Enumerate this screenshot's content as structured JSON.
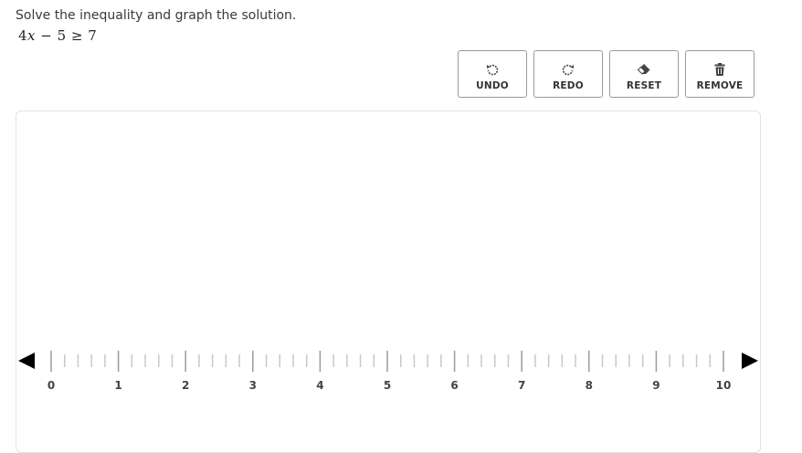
{
  "prompt": "Solve the inequality and graph the solution.",
  "equation": {
    "coef": "4",
    "var": "x",
    "rest": " − 5 ≥ 7"
  },
  "toolbar": {
    "undo": {
      "label": "UNDO",
      "icon": "undo-icon"
    },
    "redo": {
      "label": "REDO",
      "icon": "redo-icon"
    },
    "reset": {
      "label": "RESET",
      "icon": "eraser-icon"
    },
    "remove": {
      "label": "REMOVE",
      "icon": "trash-icon"
    }
  },
  "number_line": {
    "min": 0,
    "max": 10,
    "minor_per_unit": 5,
    "labels": [
      "0",
      "1",
      "2",
      "3",
      "4",
      "5",
      "6",
      "7",
      "8",
      "9",
      "10"
    ],
    "colors": {
      "axis": "#000000",
      "major": "#9a9a9a",
      "minor": "#c8c8c8"
    }
  }
}
